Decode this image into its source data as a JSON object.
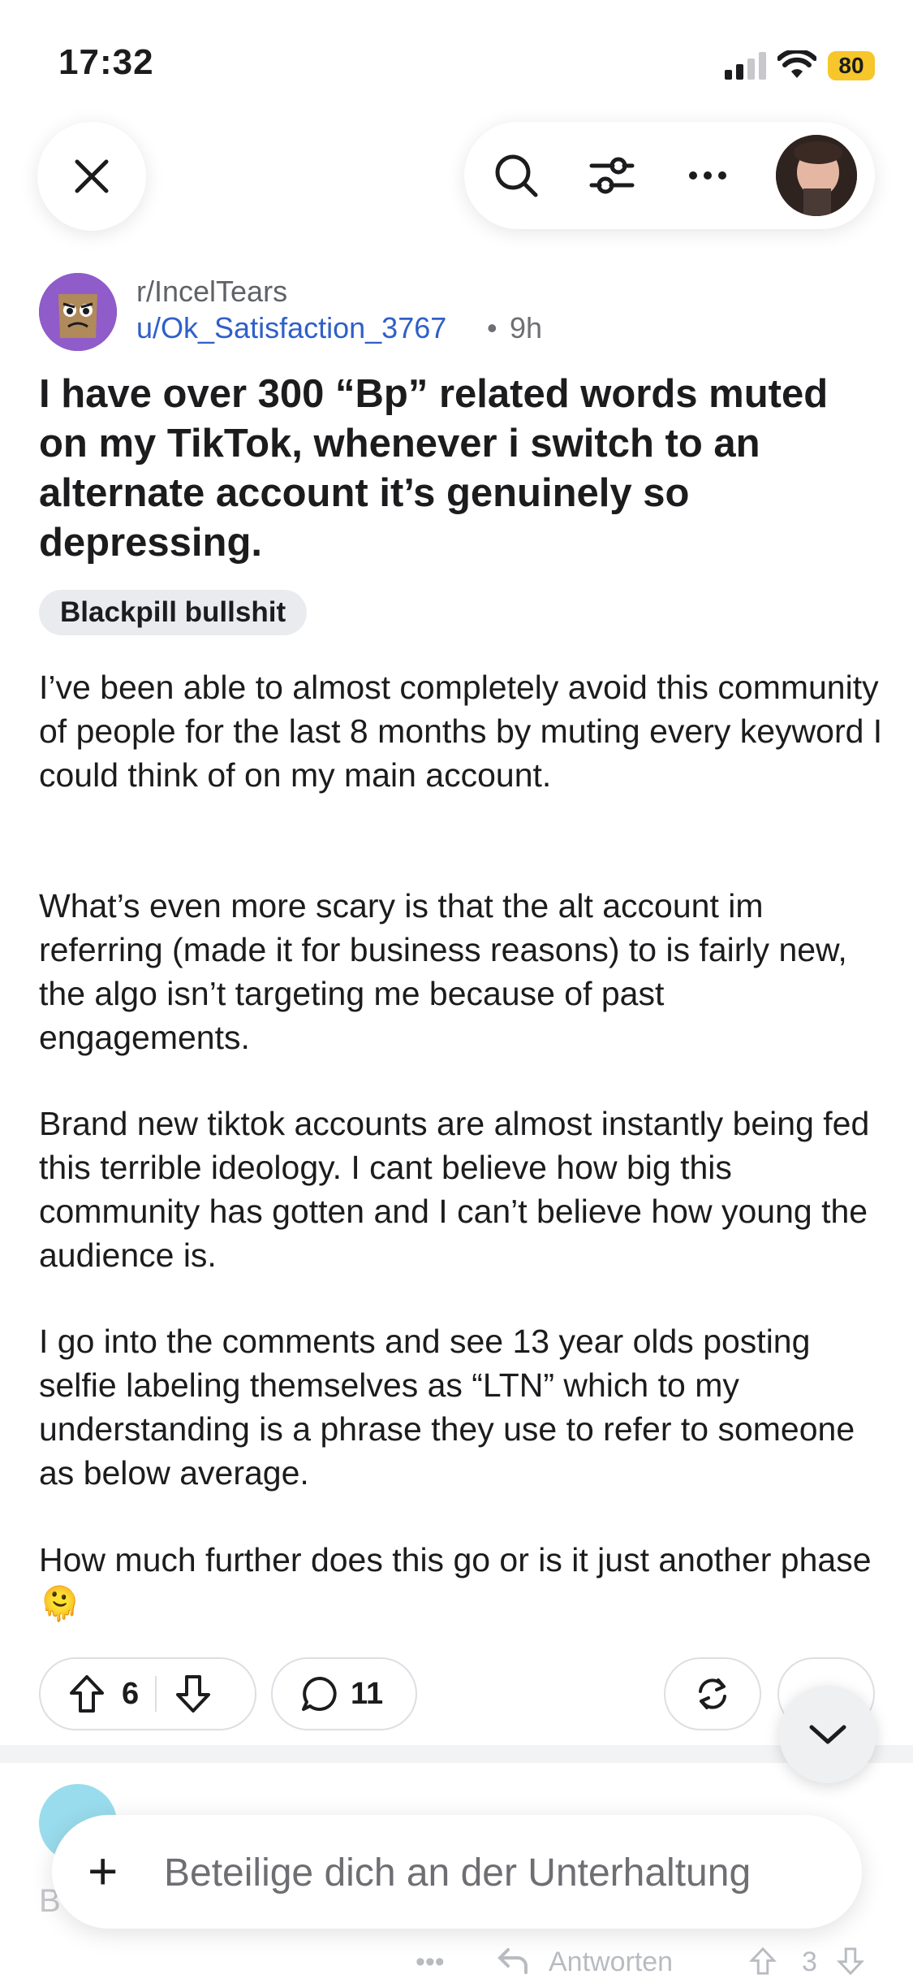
{
  "status_bar": {
    "time": "17:32",
    "battery": "80"
  },
  "post": {
    "subreddit": "r/IncelTears",
    "author": "u/Ok_Satisfaction_3767",
    "separator": "•",
    "age": "9h",
    "title": "I have over 300 “Bp” related words muted on my TikTok, whenever i switch to an alternate account it’s genuinely so depressing.",
    "flair": "Blackpill bullshit",
    "paragraphs": [
      "I’ve been able to almost completely avoid this community of people for the last 8 months by muting every keyword I could think of on my main account.",
      "What’s even more scary is that the alt account im referring (made it for business reasons) to is fairly new, the algo isn’t targeting me because of past engagements.",
      "Brand new tiktok accounts are almost instantly being fed this terrible ideology. I cant believe how big this community has gotten and I can’t believe how young the audience is.",
      "I go into the comments and see 13 year olds posting selfie labeling themselves as “LTN” which to my understanding is a phrase they use to refer to someone as below average.",
      "How much further does this go or is it just another phase 🫠"
    ],
    "votes": "6",
    "comments": "11"
  },
  "comment_preview": {
    "prefix": "B",
    "reply_label": "Antworten",
    "more": "•••",
    "votes": "3"
  },
  "reply_bar": {
    "plus": "+",
    "placeholder": "Beteilige dich an der Unterhaltung"
  },
  "icons": [
    "close-icon",
    "search-icon",
    "filter-icon",
    "more-icon",
    "upvote-icon",
    "downvote-icon",
    "comment-icon",
    "share-icon",
    "chevron-down-icon"
  ]
}
